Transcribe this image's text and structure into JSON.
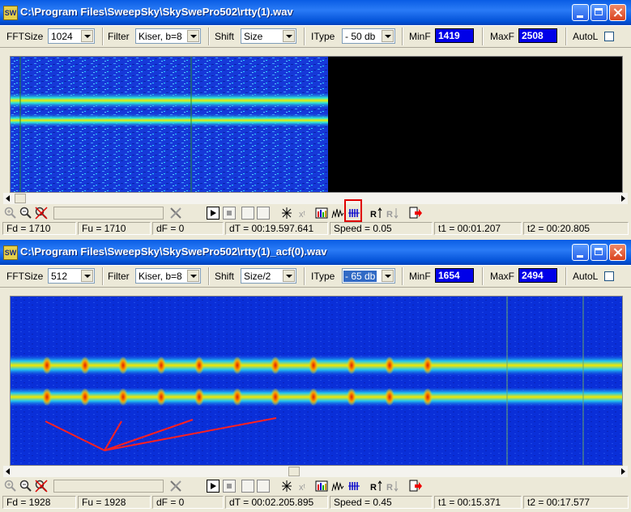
{
  "window1": {
    "title": "C:\\Program Files\\SweepSky\\SkySwePro502\\rtty(1).wav",
    "app_icon": "SW",
    "toolbar": {
      "fftsize_label": "FFTSize",
      "fftsize_value": "1024",
      "filter_label": "Filter",
      "filter_value": "Kiser, b=8",
      "shift_label": "Shift",
      "shift_value": "Size",
      "itype_label": "IType",
      "itype_value": "- 50 db",
      "minf_label": "MinF",
      "minf_value": "1419",
      "maxf_label": "MaxF",
      "maxf_value": "2508",
      "autol_label": "AutoL"
    },
    "status": {
      "fd": "Fd = 1710",
      "fu": "Fu = 1710",
      "df": "dF = 0",
      "dt": "dT = 00:19.597.641",
      "speed": "Speed = 0.05",
      "t1": "t1 = 00:01.207",
      "t2": "t2 = 00:20.805"
    }
  },
  "window2": {
    "title": "C:\\Program Files\\SweepSky\\SkySwePro502\\rtty(1)_acf(0).wav",
    "app_icon": "SW",
    "toolbar": {
      "fftsize_label": "FFTSize",
      "fftsize_value": "512",
      "filter_label": "Filter",
      "filter_value": "Kiser, b=8",
      "shift_label": "Shift",
      "shift_value": "Size/2",
      "itype_label": "IType",
      "itype_value": "- 65 db",
      "minf_label": "MinF",
      "minf_value": "1654",
      "maxf_label": "MaxF",
      "maxf_value": "2494",
      "autol_label": "AutoL"
    },
    "status": {
      "fd": "Fd = 1928",
      "fu": "Fu = 1928",
      "df": "dF = 0",
      "dt": "dT = 00:02.205.895",
      "speed": "Speed = 0.45",
      "t1": "t1 = 00:15.371",
      "t2": "t2 = 00:17.577"
    }
  },
  "colors": {
    "title_blue": "#0a5de4",
    "spectrum_bg": "#0a2fd8",
    "spectrum_signal": "#f2e800",
    "marker_line": "#2c8a2c",
    "highlight_box": "#e00000",
    "annotation": "#ff2020",
    "value_box": "#0000e8"
  },
  "icons": {
    "controls": [
      "zoom-in-icon",
      "zoom-out-icon",
      "reset-zoom-icon",
      "tools-icon",
      "play-icon",
      "stop-icon",
      "blank-button",
      "blank-button",
      "marker-icon",
      "xt-icon",
      "color-bars-icon",
      "waveform-icon",
      "comb-icon",
      "rt-icon",
      "rd-icon",
      "export-icon"
    ]
  }
}
